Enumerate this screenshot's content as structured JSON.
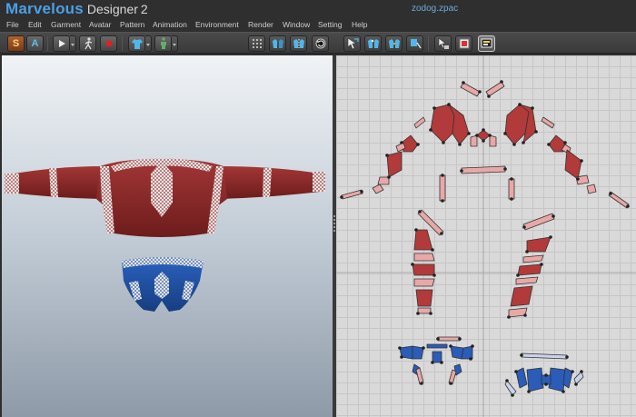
{
  "app": {
    "brand": "Marvelous",
    "product": "Designer",
    "version": "2",
    "filename": "zodog.zpac"
  },
  "menu": [
    "File",
    "Edit",
    "Garment",
    "Avatar",
    "Pattern",
    "Animation",
    "Environment",
    "Render",
    "Window",
    "Setting",
    "Help"
  ],
  "toolbar": {
    "simulate_label": "S",
    "avatar_label": "A"
  },
  "colors": {
    "shirt_red": "#8b2626",
    "trunks_blue": "#1f4fa0",
    "pattern_red": "#b23a3a",
    "pattern_pink": "#e8a8a8",
    "pattern_blue": "#2a5cb8",
    "grid": "#c6c6c6",
    "accent_blue": "#4aa0e6"
  },
  "icons": {
    "simulate": "simulate-icon",
    "avatar": "avatar-icon",
    "play": "play-icon",
    "walk": "walk-pose-icon",
    "record": "record-icon",
    "garment": "shirt-icon",
    "avatar_figure": "avatar-figure-icon",
    "points": "points-icon",
    "fold": "fold-icon",
    "sew": "sew-icon",
    "reset": "reset-icon",
    "transform": "transform-pattern-icon",
    "segment": "edit-segment-icon",
    "seam": "seam-icon",
    "internal": "internal-line-icon",
    "select_mesh": "select-mesh-icon",
    "texture": "texture-icon",
    "display": "display-icon"
  }
}
